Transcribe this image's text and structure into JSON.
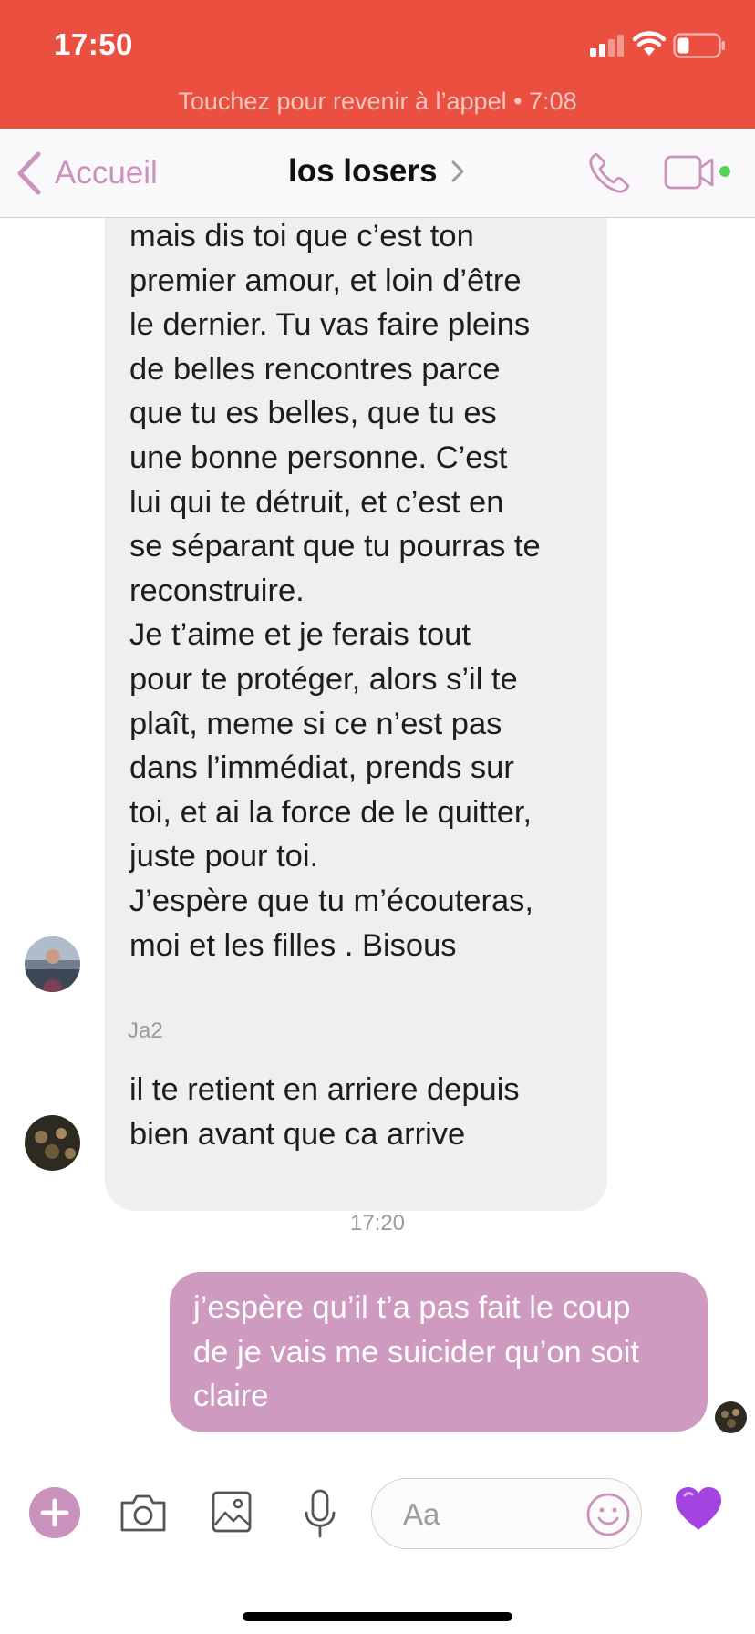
{
  "status_bar": {
    "time": "17:50",
    "call_banner": "Touchez pour revenir à l’appel • 7:08",
    "background_color": "#ea4f3f",
    "icons": [
      "cellular-signal-icon",
      "wifi-icon",
      "battery-icon"
    ]
  },
  "nav": {
    "back_label": "Accueil",
    "title": "los losers",
    "accent_color": "#c993bd",
    "icons": [
      "chevron-left-icon",
      "chevron-right-icon",
      "phone-icon",
      "video-camera-icon"
    ],
    "video_status_color": "#55d452"
  },
  "messages": [
    {
      "direction": "incoming",
      "lines": [
        "mais dis toi que c’est ton",
        "premier amour, et loin d’être",
        "le dernier. Tu vas faire pleins",
        "de belles rencontres parce",
        "que tu es belles, que tu es",
        "une bonne personne. C’est",
        "lui qui te détruit, et c’est en",
        "se séparant que tu pourras te",
        "reconstruire.",
        "Je t’aime et je ferais tout",
        "pour te protéger, alors s’il te",
        "plaît, meme si ce n’est pas",
        "dans l’immédiat, prends sur",
        "toi, et ai la force de le quitter,",
        "juste pour toi.",
        "J’espère que tu m’écouteras,",
        "moi et les filles . Bisous"
      ]
    },
    {
      "direction": "incoming",
      "sender": "Ja2",
      "lines": [
        "il te retient en arriere depuis",
        "bien avant que ca arrive"
      ]
    },
    {
      "timestamp": "17:20"
    },
    {
      "direction": "outgoing",
      "lines": [
        "j’espère qu’il t’a pas fait le coup",
        "de je vais me suicider qu’on soit",
        "claire"
      ]
    }
  ],
  "composer": {
    "placeholder": "Aa",
    "icons": [
      "plus-icon",
      "camera-icon",
      "image-icon",
      "microphone-icon",
      "emoji-icon",
      "heart-icon"
    ],
    "heart_color": "#a344e0"
  }
}
